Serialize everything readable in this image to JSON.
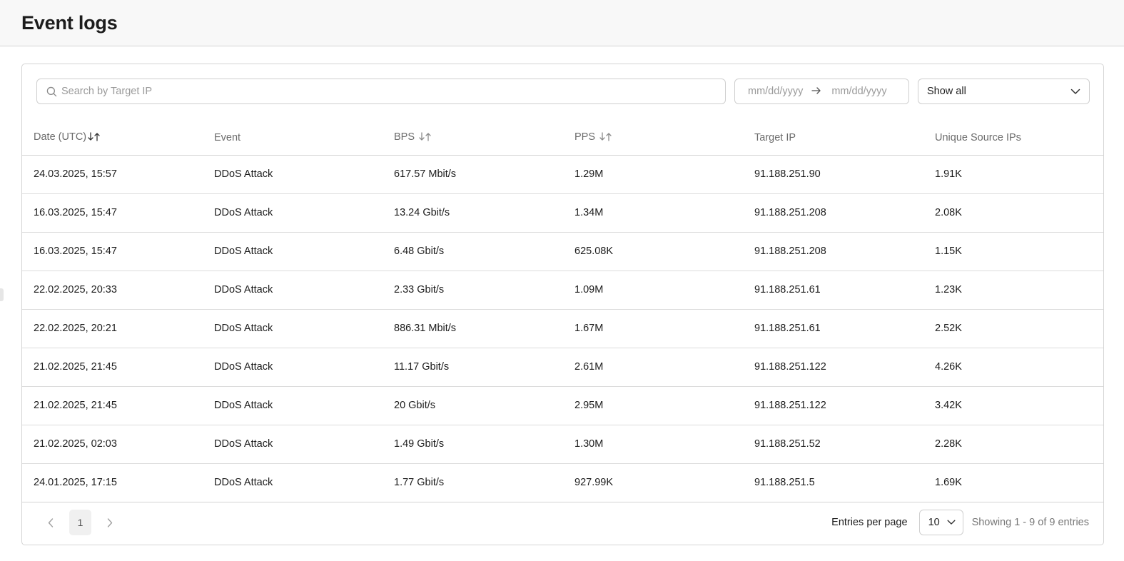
{
  "header": {
    "title": "Event logs"
  },
  "filters": {
    "search_placeholder": "Search by Target IP",
    "date_from_placeholder": "mm/dd/yyyy",
    "date_to_placeholder": "mm/dd/yyyy",
    "event_filter": "Show all"
  },
  "table": {
    "columns": [
      "Date (UTC)",
      "Event",
      "BPS",
      "PPS",
      "Target IP",
      "Unique Source IPs"
    ],
    "rows": [
      [
        "24.03.2025, 15:57",
        "DDoS Attack",
        "617.57 Mbit/s",
        "1.29M",
        "91.188.251.90",
        "1.91K"
      ],
      [
        "16.03.2025, 15:47",
        "DDoS Attack",
        "13.24 Gbit/s",
        "1.34M",
        "91.188.251.208",
        "2.08K"
      ],
      [
        "16.03.2025, 15:47",
        "DDoS Attack",
        "6.48 Gbit/s",
        "625.08K",
        "91.188.251.208",
        "1.15K"
      ],
      [
        "22.02.2025, 20:33",
        "DDoS Attack",
        "2.33 Gbit/s",
        "1.09M",
        "91.188.251.61",
        "1.23K"
      ],
      [
        "22.02.2025, 20:21",
        "DDoS Attack",
        "886.31 Mbit/s",
        "1.67M",
        "91.188.251.61",
        "2.52K"
      ],
      [
        "21.02.2025, 21:45",
        "DDoS Attack",
        "11.17 Gbit/s",
        "2.61M",
        "91.188.251.122",
        "4.26K"
      ],
      [
        "21.02.2025, 21:45",
        "DDoS Attack",
        "20 Gbit/s",
        "2.95M",
        "91.188.251.122",
        "3.42K"
      ],
      [
        "21.02.2025, 02:03",
        "DDoS Attack",
        "1.49 Gbit/s",
        "1.30M",
        "91.188.251.52",
        "2.28K"
      ],
      [
        "24.01.2025, 17:15",
        "DDoS Attack",
        "1.77 Gbit/s",
        "927.99K",
        "91.188.251.5",
        "1.69K"
      ]
    ]
  },
  "pagination": {
    "current_page": "1",
    "entries_label": "Entries per page",
    "entries_value": "10",
    "showing_text": "Showing 1 - 9 of 9 entries"
  },
  "icons": {
    "search": "search-icon",
    "arrow": "arrow-right-icon",
    "chevron": "chevron-down-icon",
    "sort": "sort-icon",
    "prev": "chevron-left-icon",
    "next": "chevron-right-icon"
  },
  "colors": {
    "border": "#d4d4d4",
    "header_bg": "#f8f8f8",
    "muted_text": "#6b6b6b",
    "page_num_bg": "#f0f0f0"
  }
}
